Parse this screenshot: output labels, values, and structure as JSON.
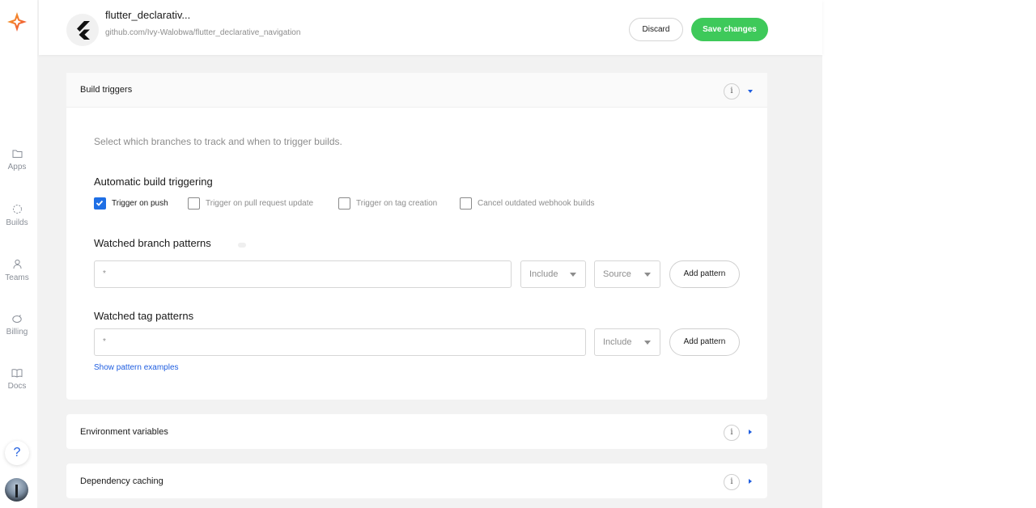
{
  "sidebar": {
    "items": [
      {
        "label": "Apps",
        "icon": "folder-icon"
      },
      {
        "label": "Builds",
        "icon": "builds-icon"
      },
      {
        "label": "Teams",
        "icon": "person-icon"
      },
      {
        "label": "Billing",
        "icon": "piggy-bank-icon"
      },
      {
        "label": "Docs",
        "icon": "book-icon"
      }
    ],
    "help_label": "?"
  },
  "header": {
    "app_name": "flutter_declarativ...",
    "repo": "github.com/Ivy-Walobwa/flutter_declarative_navigation",
    "discard_label": "Discard",
    "save_label": "Save changes"
  },
  "build_triggers": {
    "title": "Build triggers",
    "info": "i",
    "description": "Select which branches to track and when to trigger builds.",
    "auto_title": "Automatic build triggering",
    "options": [
      {
        "label": "Trigger on push",
        "checked": true
      },
      {
        "label": "Trigger on pull request update",
        "checked": false
      },
      {
        "label": "Trigger on tag creation",
        "checked": false
      },
      {
        "label": "Cancel outdated webhook builds",
        "checked": false
      }
    ],
    "branch_title": "Watched branch patterns",
    "branch_pattern_value": "*",
    "branch_include": "Include",
    "branch_source": "Source",
    "branch_add_label": "Add pattern",
    "tag_title": "Watched tag patterns",
    "tag_pattern_value": "*",
    "tag_include": "Include",
    "tag_add_label": "Add pattern",
    "examples_link": "Show pattern examples"
  },
  "env_vars": {
    "title": "Environment variables",
    "info": "i"
  },
  "dep_caching": {
    "title": "Dependency caching",
    "info": "i"
  },
  "colors": {
    "accent": "#1f6fe5",
    "save_green": "#3ec95a",
    "logo_red": "#f0473c",
    "logo_orange": "#f5a623"
  }
}
